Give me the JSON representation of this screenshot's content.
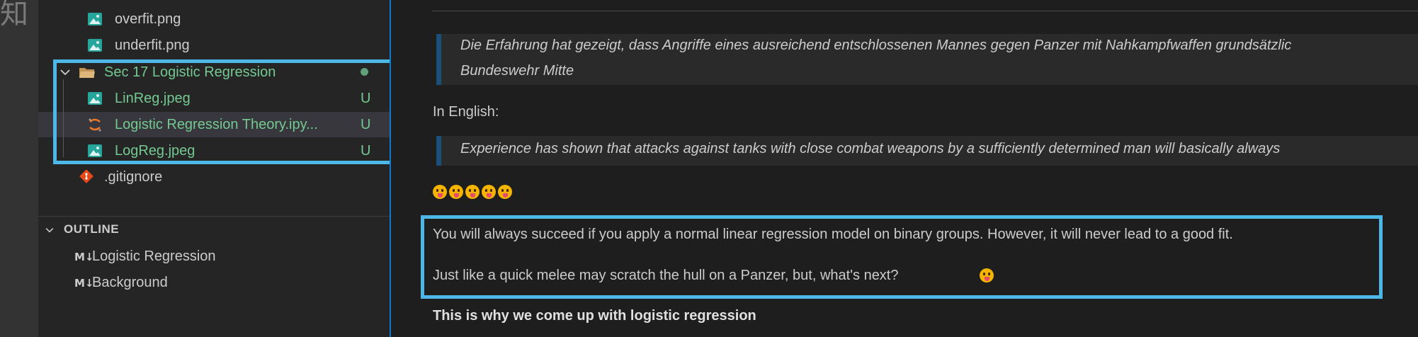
{
  "activity_bar": {
    "glyph": "知"
  },
  "explorer": {
    "items": [
      {
        "name": "overfit.png",
        "icon": "image-icon",
        "status": ""
      },
      {
        "name": "underfit.png",
        "icon": "image-icon",
        "status": ""
      },
      {
        "name": "Sec 17 Logistic Regression",
        "icon": "folder-open-icon",
        "status": "dot"
      },
      {
        "name": "LinReg.jpeg",
        "icon": "image-icon",
        "status": "U"
      },
      {
        "name": "Logistic Regression Theory.ipy...",
        "icon": "jupyter-icon",
        "status": "U"
      },
      {
        "name": "LogReg.jpeg",
        "icon": "image-icon",
        "status": "U"
      },
      {
        "name": ".gitignore",
        "icon": "git-icon",
        "status": ""
      }
    ]
  },
  "outline": {
    "header": "OUTLINE",
    "md_badge": "M↓",
    "items": [
      "Logistic Regression",
      "Background"
    ]
  },
  "editor": {
    "quote_de_line1": "Die Erfahrung hat gezeigt, dass Angriffe eines ausreichend entschlossenen Mannes gegen Panzer mit Nahkampfwaffen grundsätzlic",
    "quote_de_line2": "Bundeswehr Mitte",
    "in_english": "In English:",
    "quote_en": "Experience has shown that attacks against tanks with close combat weapons by a sufficiently determined man will basically always",
    "para1": "You will always succeed if you apply a normal linear regression model on binary groups. However, it will never lead to a good fit.",
    "para2": "Just like a quick melee may scratch the hull on a Panzer, but, what's next?",
    "bold_line": "This is why we come up with logistic regression"
  },
  "colors": {
    "highlight_border": "#4db8e8",
    "untracked_green": "#73c991",
    "quote_bar": "#1b4f7a",
    "focus_border": "#0a7acc"
  }
}
